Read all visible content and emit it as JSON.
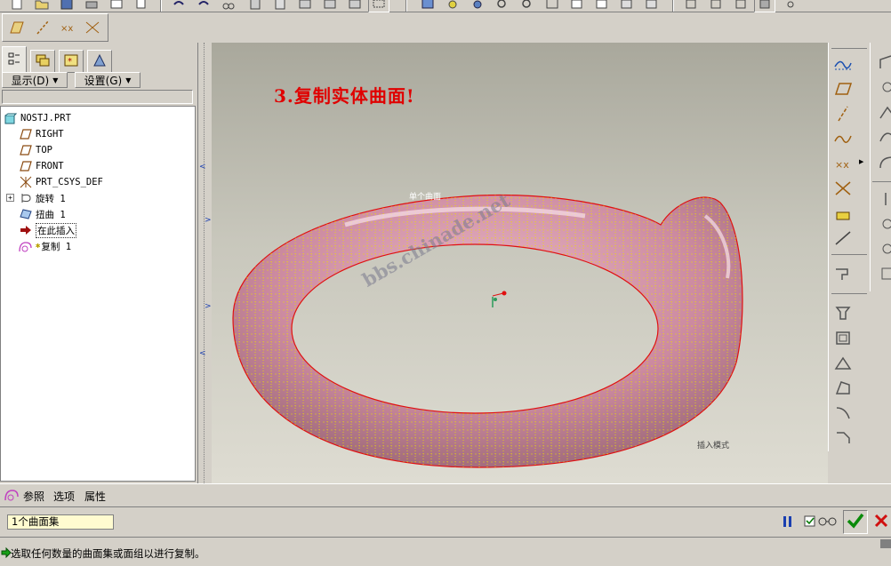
{
  "colors": {
    "chrome": "#d4d0c8",
    "model_fill": "#d89aae",
    "model_edge": "#e01010",
    "mesh": "#e8e000",
    "annotation": "#e00000",
    "viewport_top": "#a9a89c",
    "viewport_bottom": "#dddcd2"
  },
  "nav_tabs": [
    {
      "icon": "model-tree-icon"
    },
    {
      "icon": "layer-tree-icon"
    },
    {
      "icon": "favorites-icon"
    },
    {
      "icon": "connections-icon"
    }
  ],
  "tree_toolbar": {
    "display_label": "显示(D)",
    "settings_label": "设置(G)"
  },
  "model_tree": [
    {
      "label": "NOSTJ.PRT",
      "icon": "part-icon",
      "indent": 0
    },
    {
      "label": "RIGHT",
      "icon": "datum-plane-icon",
      "indent": 1
    },
    {
      "label": "TOP",
      "icon": "datum-plane-icon",
      "indent": 1
    },
    {
      "label": "FRONT",
      "icon": "datum-plane-icon",
      "indent": 1
    },
    {
      "label": "PRT_CSYS_DEF",
      "icon": "csys-icon",
      "indent": 1
    },
    {
      "label": "旋转 1",
      "icon": "revolve-icon",
      "indent": 1,
      "expandable": true
    },
    {
      "label": "扭曲 1",
      "icon": "warp-icon",
      "indent": 1
    },
    {
      "label": "在此插入",
      "icon": "insert-here-arrow-icon",
      "indent": 1
    },
    {
      "label": "复制 1",
      "icon": "copy-feature-icon",
      "indent": 0
    }
  ],
  "viewport": {
    "annotation": "3.复制实体曲面!",
    "selection_label": "单个曲面",
    "watermark": "bbs.chinade.net",
    "mode_label": "插入模式"
  },
  "dashboard": {
    "tabs": [
      "参照",
      "选项",
      "属性"
    ],
    "collector_value": "1个曲面集"
  },
  "status": {
    "message": "选取任何数量的曲面集或面组以进行复制。"
  }
}
